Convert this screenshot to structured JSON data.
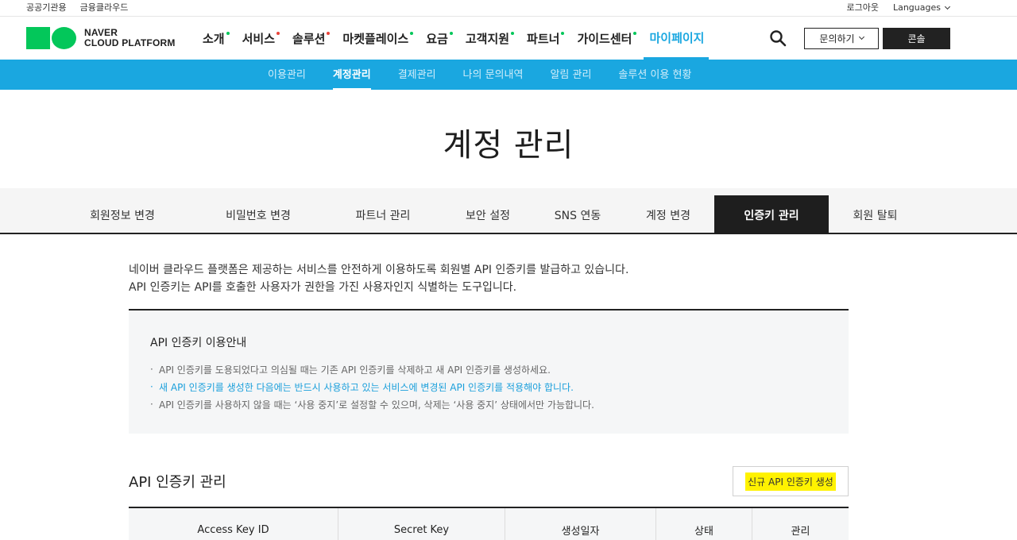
{
  "util": {
    "left_links": [
      "공공기관용",
      "금융클라우드"
    ],
    "logout": "로그아웃",
    "languages": "Languages"
  },
  "logo": {
    "line1": "NAVER",
    "line2": "CLOUD PLATFORM"
  },
  "gnb": {
    "items": [
      {
        "label": "소개",
        "dot": "#03c75a"
      },
      {
        "label": "서비스",
        "dot": "#e8443a"
      },
      {
        "label": "솔루션",
        "dot": "#e8443a"
      },
      {
        "label": "마켓플레이스",
        "dot": "#03c75a"
      },
      {
        "label": "요금",
        "dot": "#03c75a"
      },
      {
        "label": "고객지원",
        "dot": "#03c75a"
      },
      {
        "label": "파트너",
        "dot": "#03c75a"
      },
      {
        "label": "가이드센터",
        "dot": "#03c75a"
      },
      {
        "label": "마이페이지",
        "dot": ""
      }
    ],
    "inquiry_label": "문의하기",
    "console_label": "콘솔"
  },
  "subnav": {
    "items": [
      "이용관리",
      "계정관리",
      "결제관리",
      "나의 문의내역",
      "알림 관리",
      "솔루션 이용 현황"
    ],
    "active": "계정관리"
  },
  "page_title": "계정 관리",
  "tabs": {
    "items": [
      "회원정보 변경",
      "비밀번호 변경",
      "파트너 관리",
      "보안 설정",
      "SNS 연동",
      "계정 변경",
      "인증키 관리",
      "회원 탈퇴"
    ],
    "active": "인증키 관리"
  },
  "description": {
    "line1": "네이버 클라우드 플랫폼은 제공하는 서비스를 안전하게 이용하도록 회원별 API 인증키를 발급하고 있습니다.",
    "line2": "API 인증키는 API를 호출한 사용자가 권한을 가진 사용자인지 식별하는 도구입니다."
  },
  "info": {
    "title": "API 인증키 이용안내",
    "items": [
      "API 인증키를 도용되었다고 의심될 때는 기존 API 인증키를 삭제하고 새 API 인증키를 생성하세요.",
      "새 API 인증키를 생성한 다음에는 반드시 사용하고 있는 서비스에 변경된 API 인증키를 적용해야 합니다.",
      "API 인증키를 사용하지 않을 때는 ‘사용 중지’로 설정할 수 있으며, 삭제는 ‘사용 중지’ 상태에서만 가능합니다."
    ]
  },
  "section": {
    "title": "API 인증키 관리",
    "create_label": "신규 API 인증키 생성"
  },
  "table": {
    "headers": [
      "Access Key ID",
      "Secret Key",
      "생성일자",
      "상태",
      "관리"
    ]
  },
  "colors": {
    "accent": "#1aa7e0",
    "brand": "#03c75a",
    "dark": "#1e1e1e",
    "highlight": "#fff200"
  }
}
